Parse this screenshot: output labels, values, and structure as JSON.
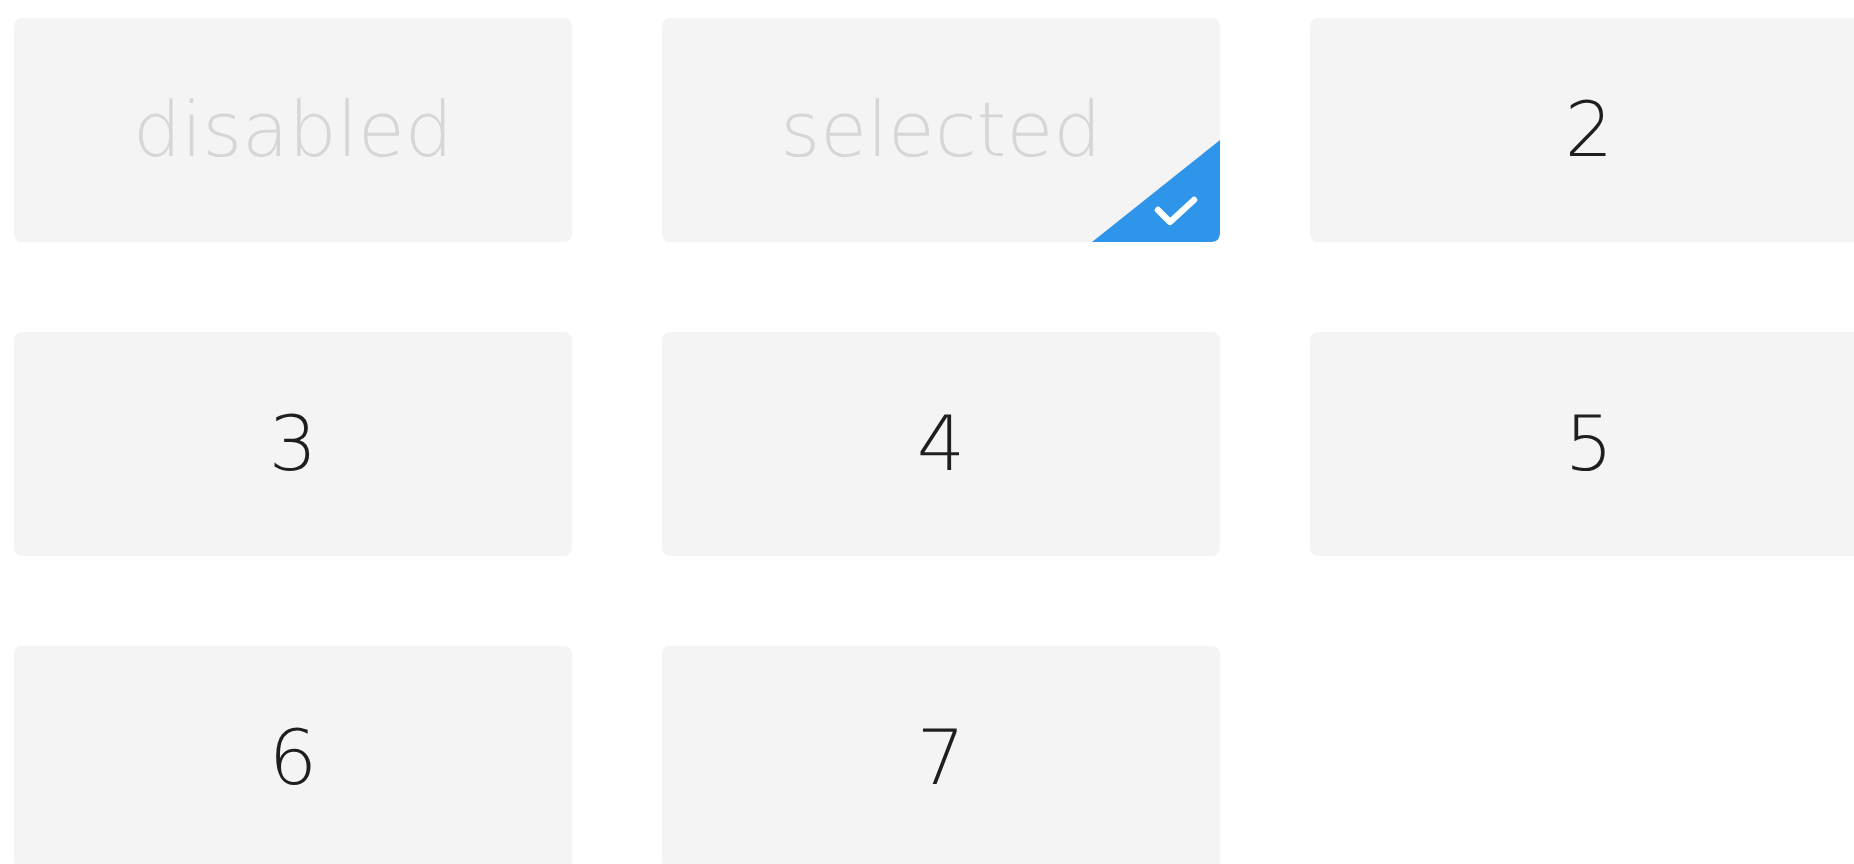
{
  "options": [
    {
      "label": "disabled",
      "disabled": true,
      "selected": false
    },
    {
      "label": "selected",
      "disabled": true,
      "selected": true
    },
    {
      "label": "2",
      "disabled": false,
      "selected": false
    },
    {
      "label": "3",
      "disabled": false,
      "selected": false
    },
    {
      "label": "4",
      "disabled": false,
      "selected": false
    },
    {
      "label": "5",
      "disabled": false,
      "selected": false
    },
    {
      "label": "6",
      "disabled": false,
      "selected": false
    },
    {
      "label": "7",
      "disabled": false,
      "selected": false
    }
  ]
}
